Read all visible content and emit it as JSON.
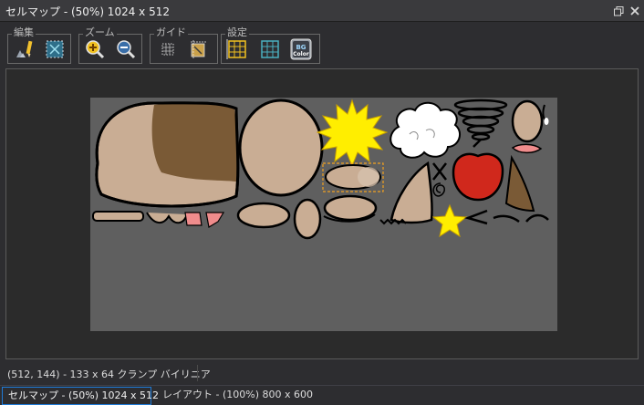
{
  "window": {
    "title": "セルマップ - (50%) 1024 x 512",
    "restore_icon": "restore-window-icon",
    "close_icon": "close-icon"
  },
  "toolbar": {
    "groups": [
      {
        "label": "編集",
        "buttons": [
          "stamp-edit-icon",
          "select-region-icon"
        ]
      },
      {
        "label": "ズーム",
        "buttons": [
          "zoom-in-icon",
          "zoom-out-icon"
        ]
      },
      {
        "label": "ガイド",
        "buttons": [
          "guide-grid-icon",
          "guide-snap-icon"
        ]
      },
      {
        "label": "設定",
        "buttons": [
          "grid-settings-icon",
          "grid-icon",
          "bg-color-icon"
        ]
      }
    ],
    "bg_color_label_1": "BG",
    "bg_color_label_2": "Color"
  },
  "colors": {
    "accent": "#1e7ad6",
    "skin": "#c9ad94",
    "brown": "#7a5a36",
    "canvas": "#5f5f5f",
    "red": "#d0281c",
    "yellow": "#ffee00"
  },
  "status": {
    "text": "(512, 144) - 133 x 64 クランプ バイリニア"
  },
  "tabs": [
    {
      "label": "セルマップ - (50%) 1024 x 512",
      "active": true
    },
    {
      "label": "レイアウト - (100%) 800 x 600",
      "active": false
    }
  ]
}
